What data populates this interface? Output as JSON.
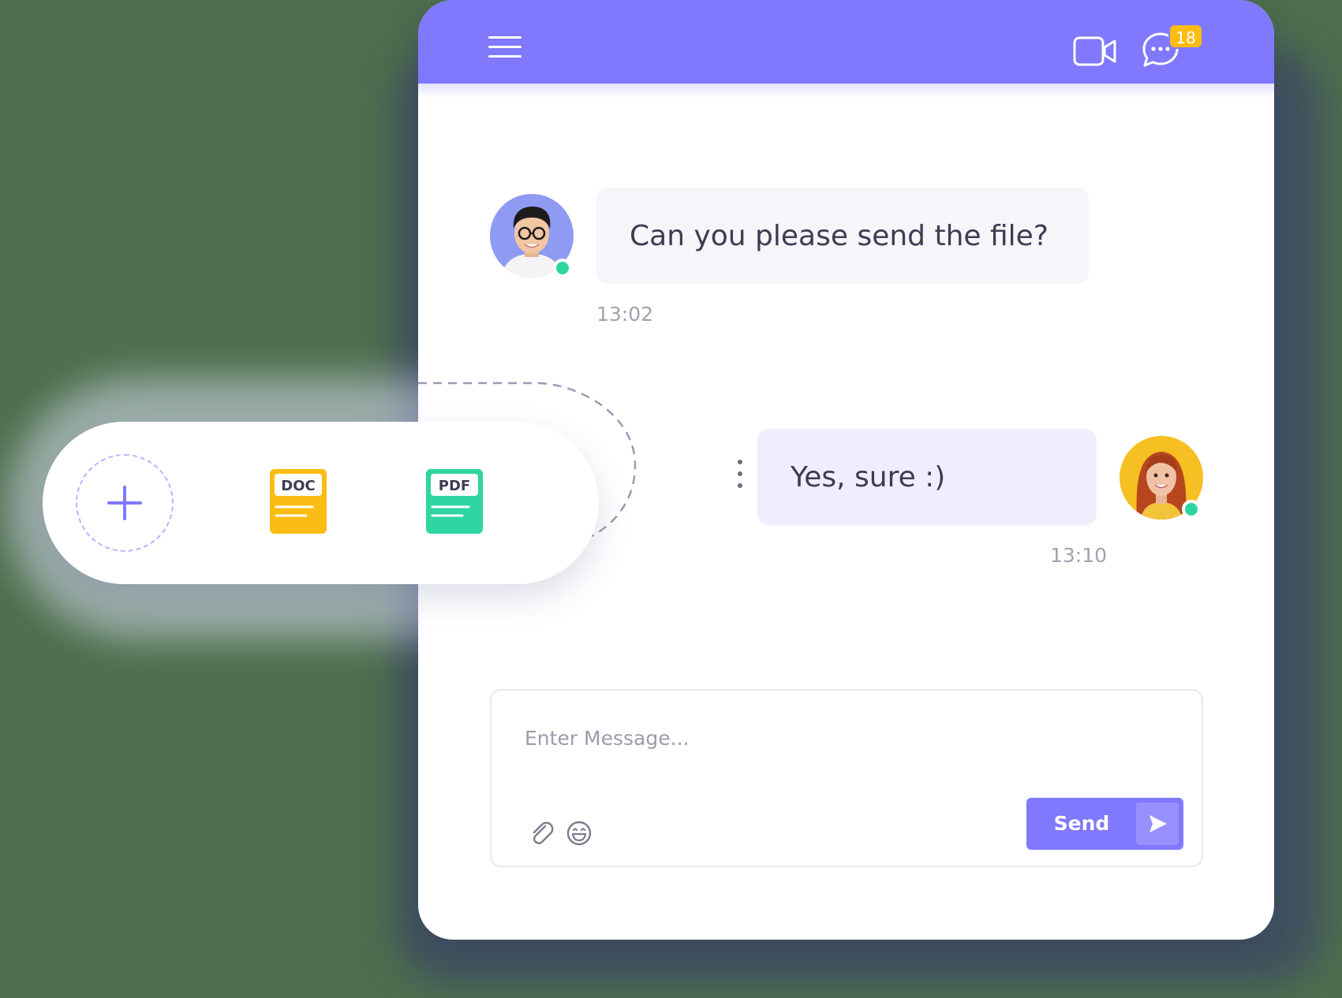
{
  "header": {
    "menu_icon": "hamburger-menu-icon",
    "video_icon": "video-camera-icon",
    "chat_icon": "chat-bubble-icon",
    "chat_badge": "18",
    "color": "#8079fd",
    "badge_color": "#fbbd13"
  },
  "messages": [
    {
      "direction": "incoming",
      "text": "Can you please send the file?",
      "time": "13:02",
      "online": true
    },
    {
      "direction": "outgoing",
      "text": "Yes, sure :)",
      "time": "13:10",
      "online": true
    }
  ],
  "composer": {
    "placeholder": "Enter Message...",
    "value": "",
    "send_label": "Send",
    "attach_icon": "paperclip-icon",
    "emoji_icon": "smiley-icon",
    "send_icon": "send-arrow-icon"
  },
  "attachments": {
    "add_icon": "plus-icon",
    "files": [
      {
        "label": "DOC",
        "color": "#fbbd13"
      },
      {
        "label": "PDF",
        "color": "#2fd5a1"
      }
    ]
  },
  "status_color": "#2fd5a1"
}
